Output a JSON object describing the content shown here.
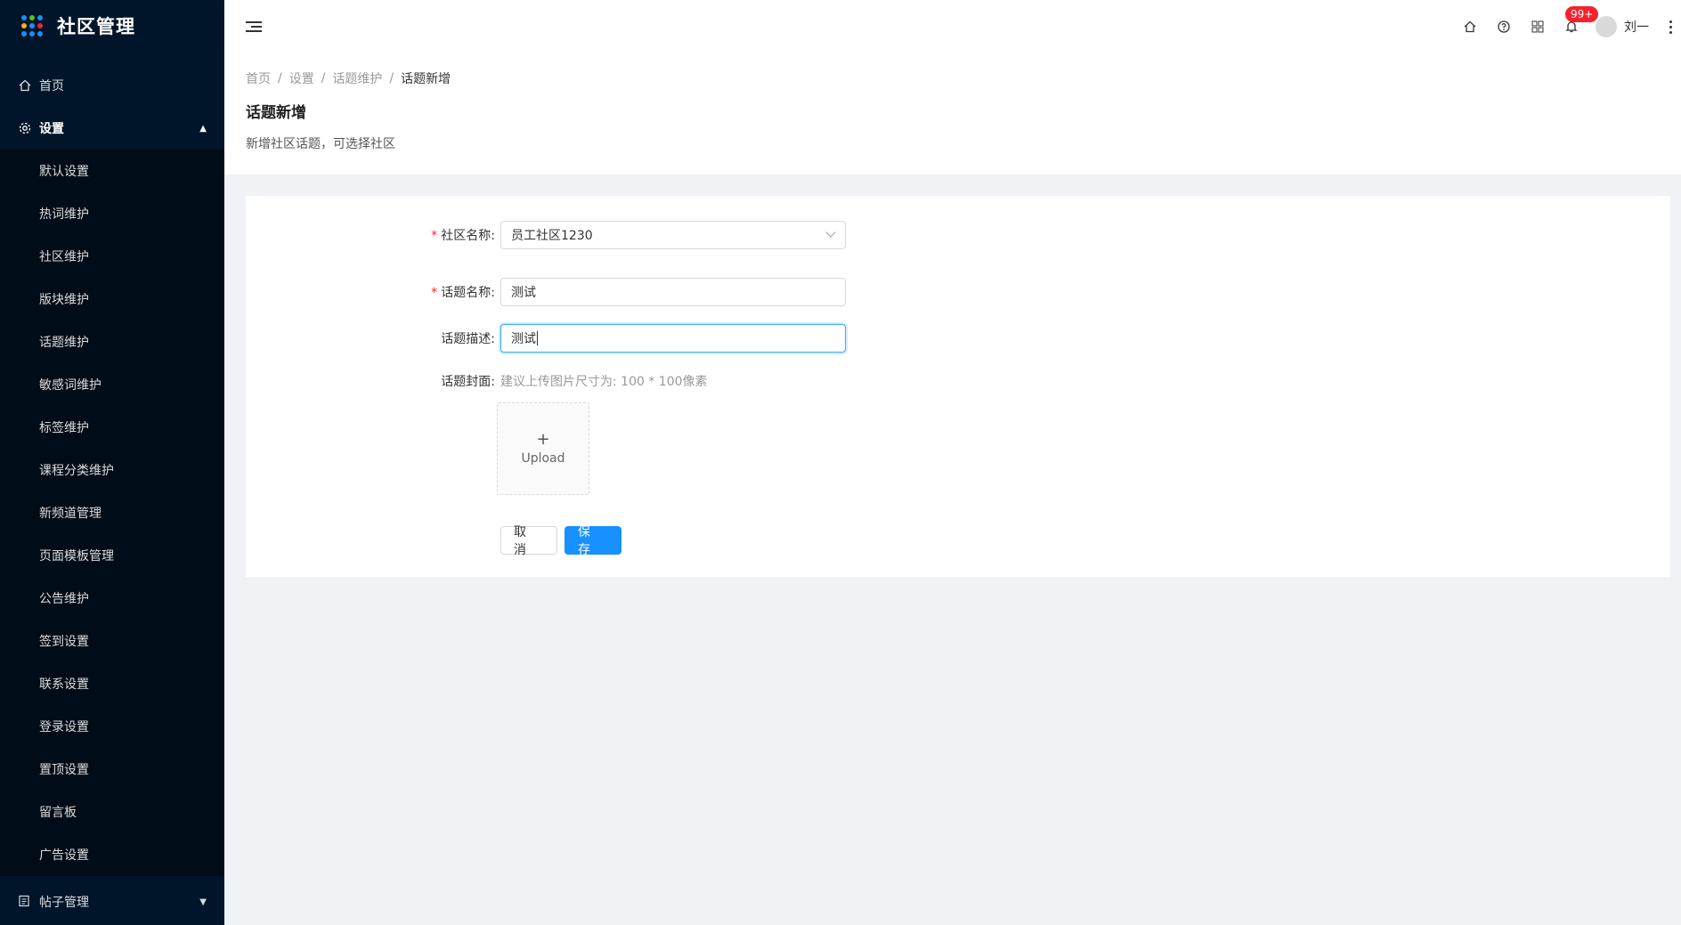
{
  "app": {
    "title": "社区管理"
  },
  "sidebar": {
    "home": "首页",
    "settings": "设置",
    "sub_items": [
      "默认设置",
      "热词维护",
      "社区维护",
      "版块维护",
      "话题维护",
      "敏感词维护",
      "标签维护",
      "课程分类维护",
      "新频道管理",
      "页面模板管理",
      "公告维护",
      "签到设置",
      "联系设置",
      "登录设置",
      "置顶设置",
      "留言板",
      "广告设置"
    ],
    "posts": "帖子管理"
  },
  "header": {
    "badge": "99+",
    "username": "刘一",
    "icons": [
      "home-icon",
      "help-icon",
      "apps-icon",
      "bell-icon"
    ]
  },
  "breadcrumb": [
    "首页",
    "设置",
    "话题维护",
    "话题新增"
  ],
  "page": {
    "title": "话题新增",
    "description": "新增社区话题，可选择社区"
  },
  "form": {
    "community_label": "社区名称:",
    "community_value": "员工社区1230",
    "topic_label": "话题名称:",
    "topic_value": "测试",
    "desc_label": "话题描述:",
    "desc_value": "测试",
    "cover_label": "话题封面:",
    "cover_hint": "建议上传图片尺寸为: 100 * 100像素",
    "upload_label": "Upload",
    "cancel": "取 消",
    "save": "保 存",
    "required_mark": "*"
  },
  "colors": {
    "sidebar": "#001529",
    "primary": "#1890ff",
    "badge": "#f5222d"
  }
}
